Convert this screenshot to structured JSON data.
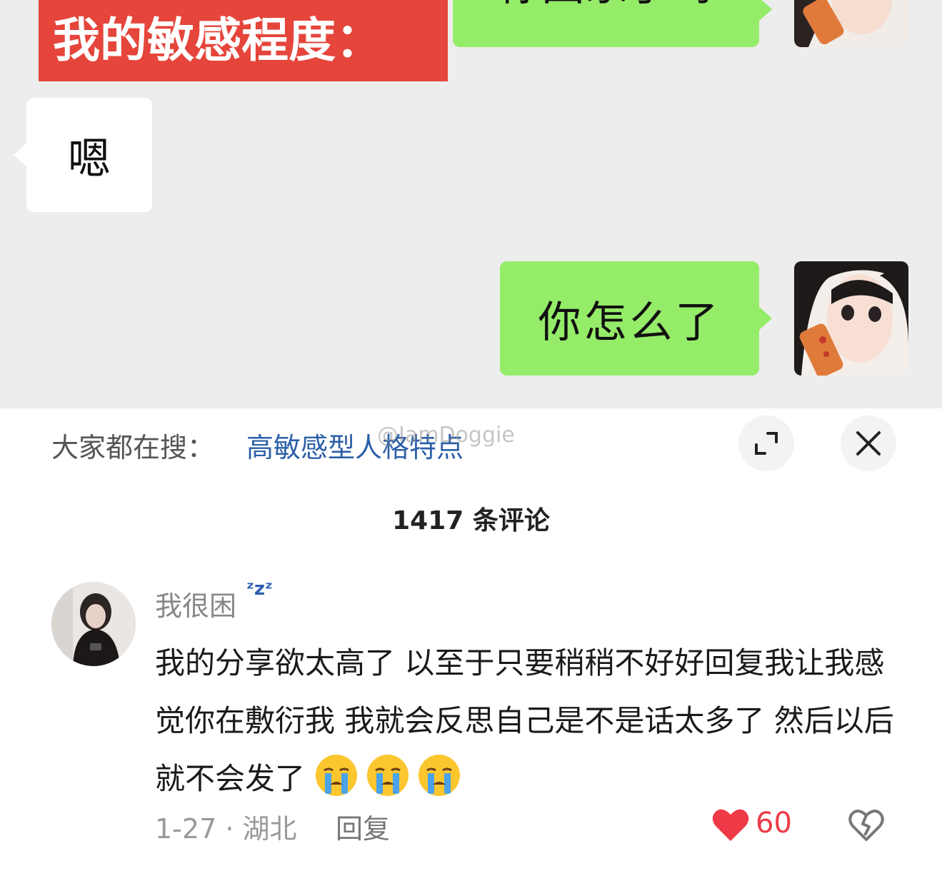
{
  "chat": {
    "header_label": "我的敏感程度：",
    "messages": [
      {
        "side": "right",
        "text": "你回家了吗"
      },
      {
        "side": "left",
        "text": "嗯"
      },
      {
        "side": "right",
        "text": "你怎么了"
      }
    ]
  },
  "search": {
    "prefix": "大家都在搜：",
    "term": "高敏感型人格特点",
    "watermark": "@IamDoggie"
  },
  "comments_header": "1417 条评论",
  "comment": {
    "username": "我很困",
    "text": "我的分享欲太高了 以至于只要稍稍不好好回复我让我感觉你在敷衍我 我就会反思自己是不是话太多了 然后以后就不会发了",
    "emoji_icons": [
      "crying-face-icon",
      "crying-face-icon",
      "crying-face-icon"
    ],
    "date_location": "1-27 · 湖北",
    "reply_label": "回复",
    "likes": "60",
    "like_color": "#ee3a46"
  },
  "colors": {
    "accent_red": "#e5453b",
    "bubble_green": "#95ec69",
    "link_blue": "#2b5fa8"
  }
}
